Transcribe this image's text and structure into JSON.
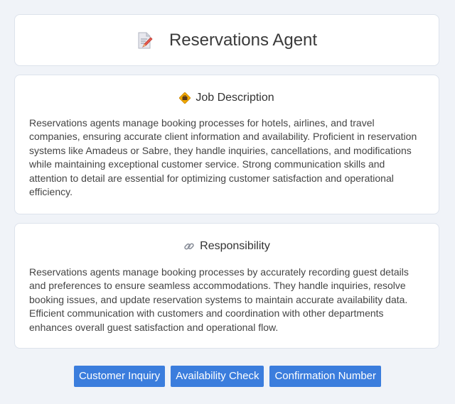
{
  "header": {
    "title": "Reservations Agent",
    "icon": "document-pencil-icon"
  },
  "job_description": {
    "heading": "Job Description",
    "icon": "briefcase-badge-icon",
    "body": "Reservations agents manage booking processes for hotels, airlines, and travel companies, ensuring accurate client information and availability. Proficient in reservation systems like Amadeus or Sabre, they handle inquiries, cancellations, and modifications while maintaining exceptional customer service. Strong communication skills and attention to detail are essential for optimizing customer satisfaction and operational efficiency."
  },
  "responsibility": {
    "heading": "Responsibility",
    "icon": "link-icon",
    "body": "Reservations agents manage booking processes by accurately recording guest details and preferences to ensure seamless accommodations. They handle inquiries, resolve booking issues, and update reservation systems to maintain accurate availability data. Efficient communication with customers and coordination with other departments enhances overall guest satisfaction and operational flow."
  },
  "tags": [
    "Customer Inquiry",
    "Availability Check",
    "Confirmation Number"
  ],
  "colors": {
    "accent": "#3b7ddd",
    "background": "#f0f3f8"
  }
}
